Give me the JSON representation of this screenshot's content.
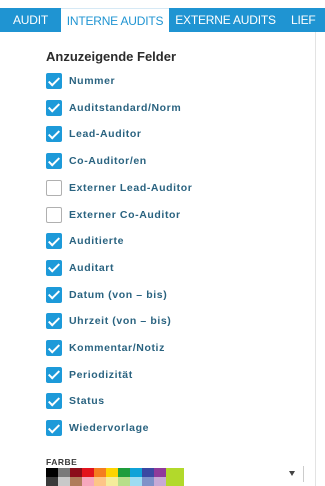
{
  "tabs": [
    {
      "label": "AUDIT",
      "active": false
    },
    {
      "label": "INTERNE AUDITS",
      "active": true
    },
    {
      "label": "EXTERNE AUDITS",
      "active": false
    },
    {
      "label": "LIEF",
      "active": false
    }
  ],
  "panel": {
    "heading": "Anzuzeigende Felder",
    "fields": [
      {
        "label": "Nummer",
        "checked": true
      },
      {
        "label": "Auditstandard/Norm",
        "checked": true
      },
      {
        "label": "Lead-Auditor",
        "checked": true
      },
      {
        "label": "Co-Auditor/en",
        "checked": true
      },
      {
        "label": "Externer Lead-Auditor",
        "checked": false
      },
      {
        "label": "Externer Co-Auditor",
        "checked": false
      },
      {
        "label": "Auditierte",
        "checked": true
      },
      {
        "label": "Auditart",
        "checked": true
      },
      {
        "label": "Datum (von – bis)",
        "checked": true
      },
      {
        "label": "Uhrzeit (von – bis)",
        "checked": true
      },
      {
        "label": "Kommentar/Notiz",
        "checked": true
      },
      {
        "label": "Periodizität",
        "checked": true
      },
      {
        "label": "Status",
        "checked": true
      },
      {
        "label": "Wiedervorlage",
        "checked": true
      }
    ],
    "color_label": "FARBE",
    "colors": {
      "accent": "#1f94d2",
      "checkbox": "#1d9ad9",
      "label_text": "#2a6380",
      "palette_top": [
        "#000000",
        "#7a7a7a",
        "#8b0e1a",
        "#e3141d",
        "#f47e20",
        "#fdd400",
        "#1e9d3c",
        "#0fa2d8",
        "#3a48a2",
        "#8f3a9a",
        "#b2d92b"
      ],
      "palette_bottom": [
        "#3b3b3b",
        "#c9c9c9",
        "#b07c5a",
        "#f7a7bd",
        "#fdc587",
        "#f5ed9b",
        "#b7de8a",
        "#9edcf2",
        "#7f92c9",
        "#c7a9d6",
        "#b2d92b"
      ]
    }
  }
}
